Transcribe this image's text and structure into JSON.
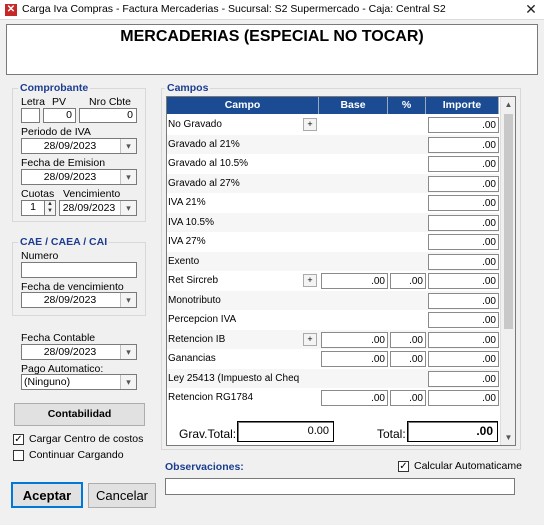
{
  "window": {
    "title": "Carga Iva Compras - Factura Mercaderias - Sucursal: S2 Supermercado - Caja: Central S2",
    "close_glyph": "✕",
    "icon": "app-x-icon"
  },
  "header": {
    "title": "MERCADERIAS (ESPECIAL NO TOCAR)"
  },
  "comprobante": {
    "group_label": "Comprobante",
    "letra_label": "Letra",
    "letra_value": "",
    "pv_label": "PV",
    "pv_value": "0",
    "nro_label": "Nro Cbte",
    "nro_value": "0",
    "periodo_label": "Periodo de IVA",
    "periodo_value": "28/09/2023",
    "emision_label": "Fecha de Emision",
    "emision_value": "28/09/2023",
    "cuotas_label": "Cuotas",
    "cuotas_value": "1",
    "vencimiento_label": "Vencimiento",
    "vencimiento_value": "28/09/2023"
  },
  "cae": {
    "group_label": "CAE / CAEA / CAI",
    "numero_label": "Numero",
    "numero_value": "",
    "fecha_venc_label": "Fecha de vencimiento",
    "fecha_venc_value": "28/09/2023"
  },
  "contable": {
    "fecha_label": "Fecha Contable",
    "fecha_value": "28/09/2023",
    "pago_label": "Pago Automatico:",
    "pago_value": "(Ninguno)",
    "contabilidad_button": "Contabilidad"
  },
  "options": {
    "centro_costos_label": "Cargar Centro de costos",
    "centro_costos_checked": true,
    "continuar_label": "Continuar Cargando",
    "continuar_checked": false,
    "calcular_label": "Calcular Automaticame",
    "calcular_checked": true,
    "check_glyph": "✓"
  },
  "campos": {
    "group_label": "Campos",
    "columns": [
      "Campo",
      "Base",
      "%",
      "Importe"
    ],
    "plus_glyph": "+",
    "rows": [
      {
        "campo": "No Gravado",
        "plus": true,
        "base": null,
        "pct": null,
        "importe": ".00"
      },
      {
        "campo": "Gravado al 21%",
        "plus": false,
        "base": null,
        "pct": null,
        "importe": ".00"
      },
      {
        "campo": "Gravado al 10.5%",
        "plus": false,
        "base": null,
        "pct": null,
        "importe": ".00"
      },
      {
        "campo": "Gravado al 27%",
        "plus": false,
        "base": null,
        "pct": null,
        "importe": ".00"
      },
      {
        "campo": "IVA 21%",
        "plus": false,
        "base": null,
        "pct": null,
        "importe": ".00"
      },
      {
        "campo": "IVA 10.5%",
        "plus": false,
        "base": null,
        "pct": null,
        "importe": ".00"
      },
      {
        "campo": "IVA 27%",
        "plus": false,
        "base": null,
        "pct": null,
        "importe": ".00"
      },
      {
        "campo": "Exento",
        "plus": false,
        "base": null,
        "pct": null,
        "importe": ".00"
      },
      {
        "campo": "Ret Sircreb",
        "plus": true,
        "base": ".00",
        "pct": ".00",
        "importe": ".00"
      },
      {
        "campo": "Monotributo",
        "plus": false,
        "base": null,
        "pct": null,
        "importe": ".00"
      },
      {
        "campo": "Percepcion IVA",
        "plus": false,
        "base": null,
        "pct": null,
        "importe": ".00"
      },
      {
        "campo": "Retencion IB",
        "plus": true,
        "base": ".00",
        "pct": ".00",
        "importe": ".00"
      },
      {
        "campo": "Ganancias",
        "plus": false,
        "base": ".00",
        "pct": ".00",
        "importe": ".00"
      },
      {
        "campo": "Ley 25413 (Impuesto al Cheq",
        "plus": false,
        "base": null,
        "pct": null,
        "importe": ".00"
      },
      {
        "campo": "Retencion RG1784",
        "plus": false,
        "base": ".00",
        "pct": ".00",
        "importe": ".00"
      }
    ],
    "grav_total_label": "Grav.Total:",
    "grav_total_value": "0.00",
    "total_label": "Total:",
    "total_value": ".00"
  },
  "observaciones": {
    "label": "Observaciones:",
    "value": ""
  },
  "footer": {
    "accept_button": "Aceptar",
    "cancel_button": "Cancelar"
  },
  "icons": {
    "dropdown": "▾",
    "spin_up": "▲",
    "spin_down": "▼",
    "scroll_up": "▲",
    "scroll_down": "▼"
  },
  "colors": {
    "grid_header": "#1a4b93",
    "group_label": "#1c3d8f",
    "app_icon": "#c62828"
  }
}
